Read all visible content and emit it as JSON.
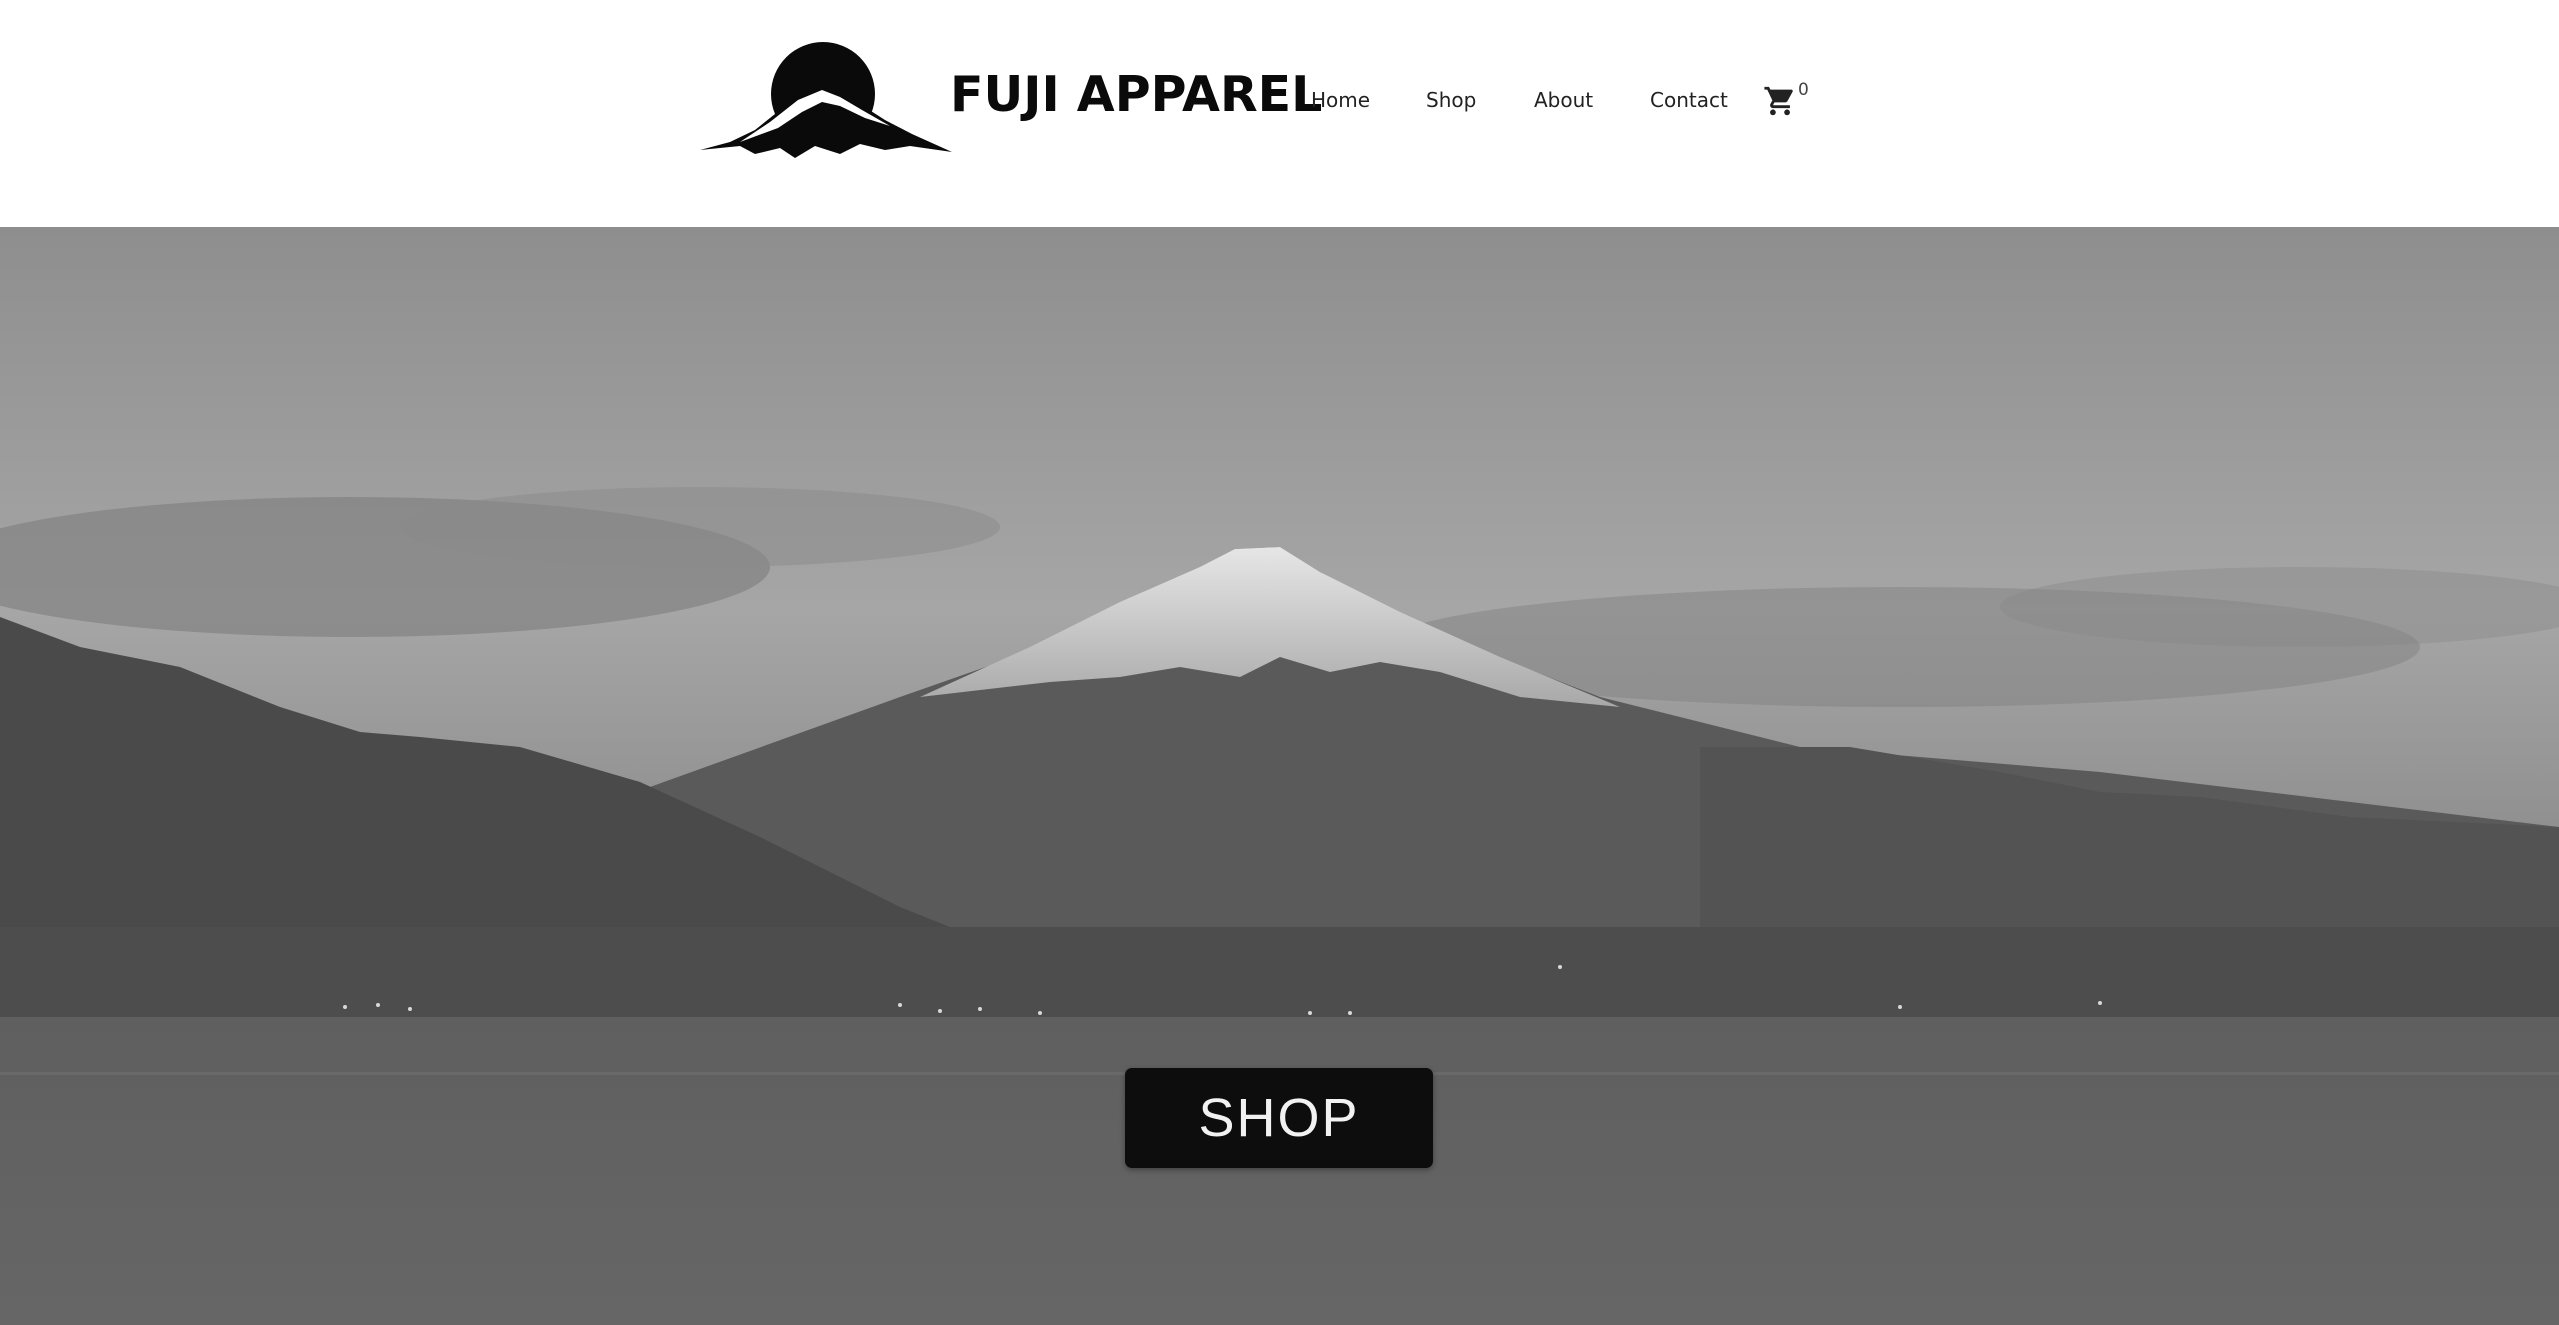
{
  "header": {
    "logo_icon": "mount-fuji-sun-logo",
    "brand_name": "FUJI APPAREL",
    "nav": [
      {
        "label": "Home"
      },
      {
        "label": "Shop"
      },
      {
        "label": "About"
      },
      {
        "label": "Contact"
      }
    ],
    "cart": {
      "icon": "shopping-cart-icon",
      "count": "0"
    }
  },
  "hero": {
    "background": "mount-fuji-lake-grayscale-photo",
    "cta_label": "SHOP"
  },
  "colors": {
    "brand_text": "#0a0a0a",
    "nav_text": "#222222",
    "button_bg": "#0d0d0d",
    "button_text": "#f2f2f2",
    "header_bg": "#ffffff"
  }
}
